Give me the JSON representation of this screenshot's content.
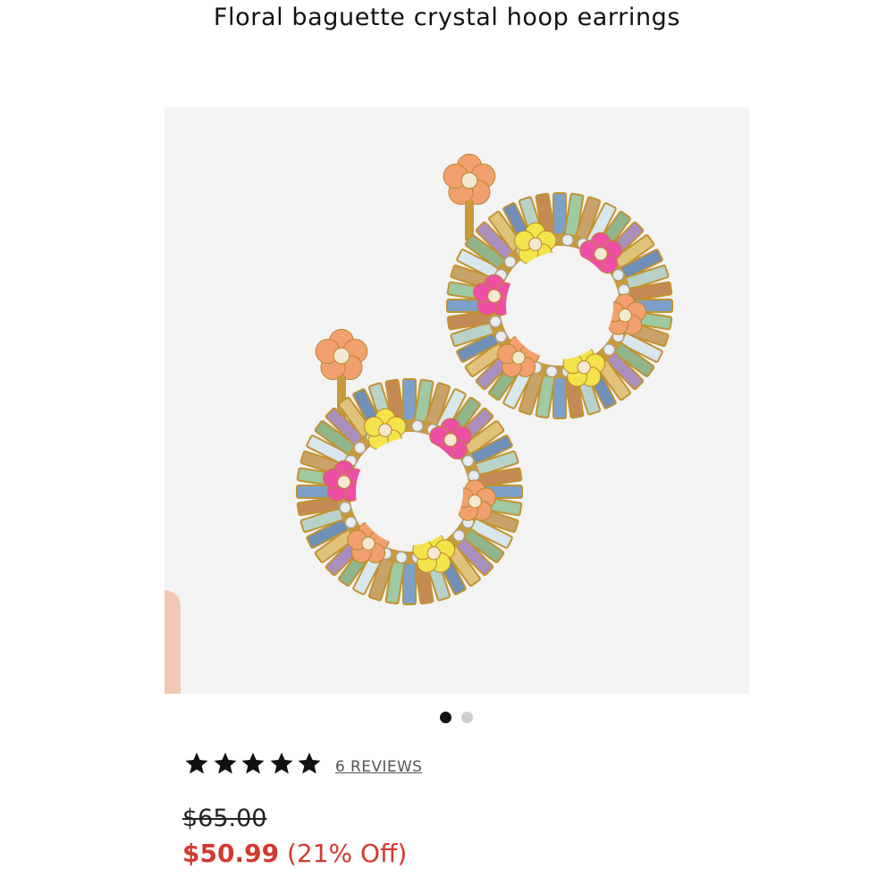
{
  "product": {
    "title": "Floral baguette crystal hoop earrings",
    "image_alt": "Floral baguette crystal hoop earrings product photo"
  },
  "gallery": {
    "expand_icon": "expand-arrows-icon",
    "dots_total": 2,
    "active_index": 0
  },
  "rating": {
    "stars": 5,
    "max_stars": 5,
    "reviews_label": "6 REVIEWS"
  },
  "pricing": {
    "original_price": "$65.00",
    "sale_price": "$50.99",
    "discount_label": "(21% Off)"
  },
  "colors": {
    "sale_red": "#d13a2f",
    "image_background": "#f3f3f3"
  }
}
